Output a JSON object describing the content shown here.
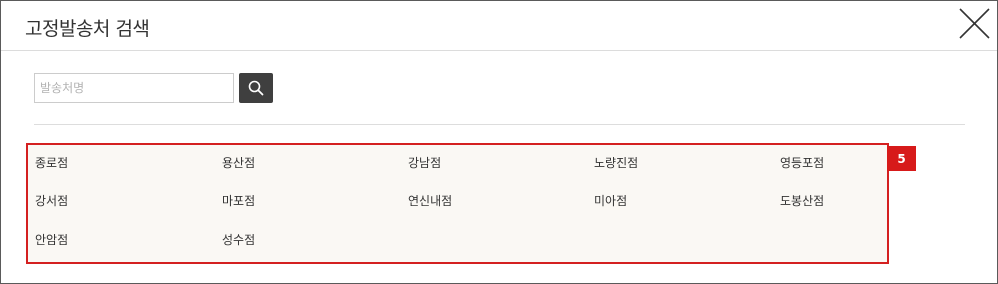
{
  "dialog": {
    "title": "고정발송처 검색",
    "close_icon": "close-icon"
  },
  "search": {
    "placeholder": "발송처명",
    "value": "",
    "button_icon": "search-icon"
  },
  "results": {
    "items": [
      "종로점",
      "용산점",
      "강남점",
      "노량진점",
      "영등포점",
      "강서점",
      "마포점",
      "연신내점",
      "미아점",
      "도봉산점",
      "안암점",
      "성수점"
    ],
    "count": "5"
  },
  "colors": {
    "highlight_border": "#d42020",
    "badge_bg": "#d71a1a",
    "search_button_bg": "#3f3f3f",
    "results_bg": "#faf8f4"
  }
}
